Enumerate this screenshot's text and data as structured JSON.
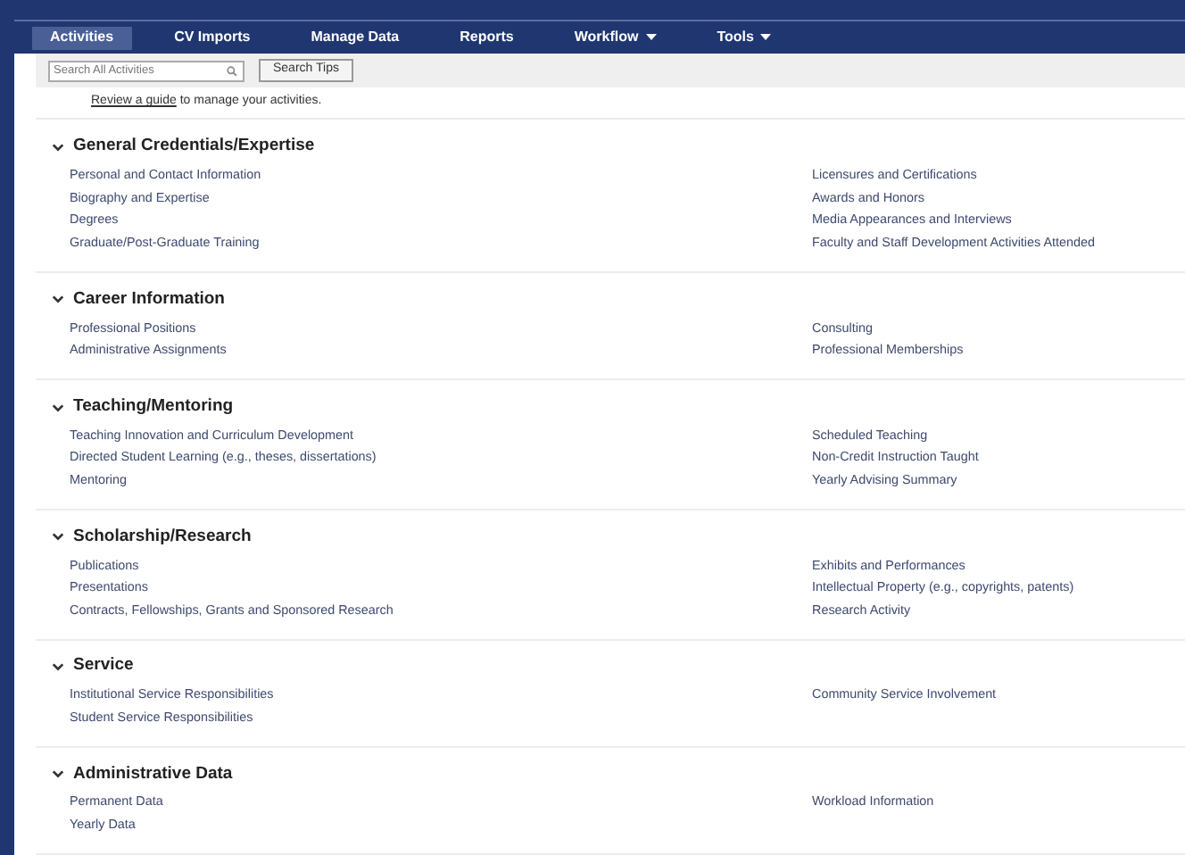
{
  "nav": [
    {
      "label": "Activities",
      "selected": true,
      "dropdown": false
    },
    {
      "label": "CV Imports",
      "selected": false,
      "dropdown": false
    },
    {
      "label": "Manage Data",
      "selected": false,
      "dropdown": false
    },
    {
      "label": "Reports",
      "selected": false,
      "dropdown": false
    },
    {
      "label": "Workflow",
      "selected": false,
      "dropdown": true
    },
    {
      "label": "Tools",
      "selected": false,
      "dropdown": true
    }
  ],
  "search": {
    "placeholder": "Search All Activities"
  },
  "search_tips_button": "Search Tips",
  "guide": {
    "link": "Review a guide",
    "text": "to manage your activities."
  },
  "sections": [
    {
      "title": "General Credentials/Expertise",
      "expanded": true,
      "left": [
        "Personal and Contact Information",
        "Biography and Expertise",
        "Degrees",
        "Graduate/Post-Graduate Training"
      ],
      "right": [
        "Licensures and Certifications",
        "Awards and Honors",
        "Media Appearances and Interviews",
        "Faculty and Staff Development Activities Attended"
      ]
    },
    {
      "title": "Career Information",
      "expanded": true,
      "left": [
        "Professional Positions",
        "Administrative Assignments"
      ],
      "right": [
        "Consulting",
        "Professional Memberships"
      ]
    },
    {
      "title": "Teaching/Mentoring",
      "expanded": true,
      "left": [
        "Teaching Innovation and Curriculum Development",
        "Directed Student Learning (e.g., theses, dissertations)",
        "Mentoring"
      ],
      "right": [
        "Scheduled Teaching",
        "Non-Credit Instruction Taught",
        "Yearly Advising Summary"
      ]
    },
    {
      "title": "Scholarship/Research",
      "expanded": true,
      "left": [
        "Publications",
        "Presentations",
        "Contracts, Fellowships, Grants and Sponsored Research"
      ],
      "right": [
        "Exhibits and Performances",
        "Intellectual Property (e.g., copyrights, patents)",
        "Research Activity"
      ]
    },
    {
      "title": "Service",
      "expanded": true,
      "left": [
        "Institutional Service Responsibilities",
        "Student Service Responsibilities"
      ],
      "right": [
        "Community Service Involvement"
      ]
    },
    {
      "title": "Administrative Data",
      "expanded": true,
      "left": [
        "Permanent Data",
        "Yearly Data"
      ],
      "right": [
        "Workload Information"
      ]
    }
  ]
}
